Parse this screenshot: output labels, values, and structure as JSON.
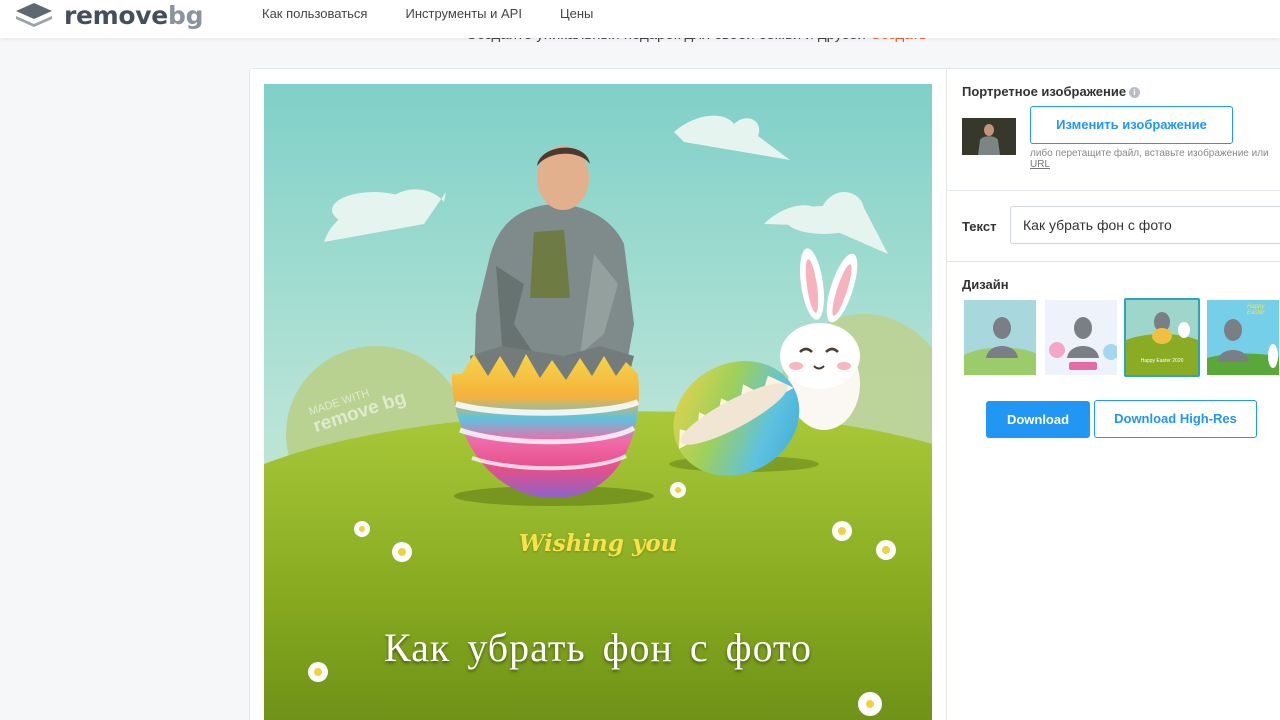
{
  "header": {
    "logo_main": "remove",
    "logo_accent": "bg",
    "nav": [
      "Как пользоваться",
      "Инструменты и API",
      "Цены"
    ]
  },
  "promo": {
    "text": "Создайте уникальный подарок для своей семьи и друзей",
    "link": "Создать"
  },
  "preview": {
    "greeting": "Wishing you",
    "title": "Как убрать фон с фото",
    "watermark_small": "MADE WITH",
    "watermark_big": "remove bg"
  },
  "panel": {
    "portrait_label": "Портретное изображение",
    "change_button": "Изменить изображение",
    "hint_text": "либо перетащите файл, вставьте изображение или",
    "hint_link": "URL",
    "text_label": "Текст",
    "text_value": "Как убрать фон с фото",
    "design_label": "Дизайн",
    "designs": [
      {
        "caption": "",
        "selected": false
      },
      {
        "caption": "",
        "selected": false
      },
      {
        "caption": "Happy Easter 2020",
        "selected": true
      },
      {
        "caption": "Happy Easter",
        "selected": false
      }
    ],
    "download_button": "Download",
    "download_hires_button": "Download High-Res"
  },
  "colors": {
    "accent": "#2196f3",
    "promo_link": "#f1612e",
    "selected_border": "#29a6b8"
  }
}
